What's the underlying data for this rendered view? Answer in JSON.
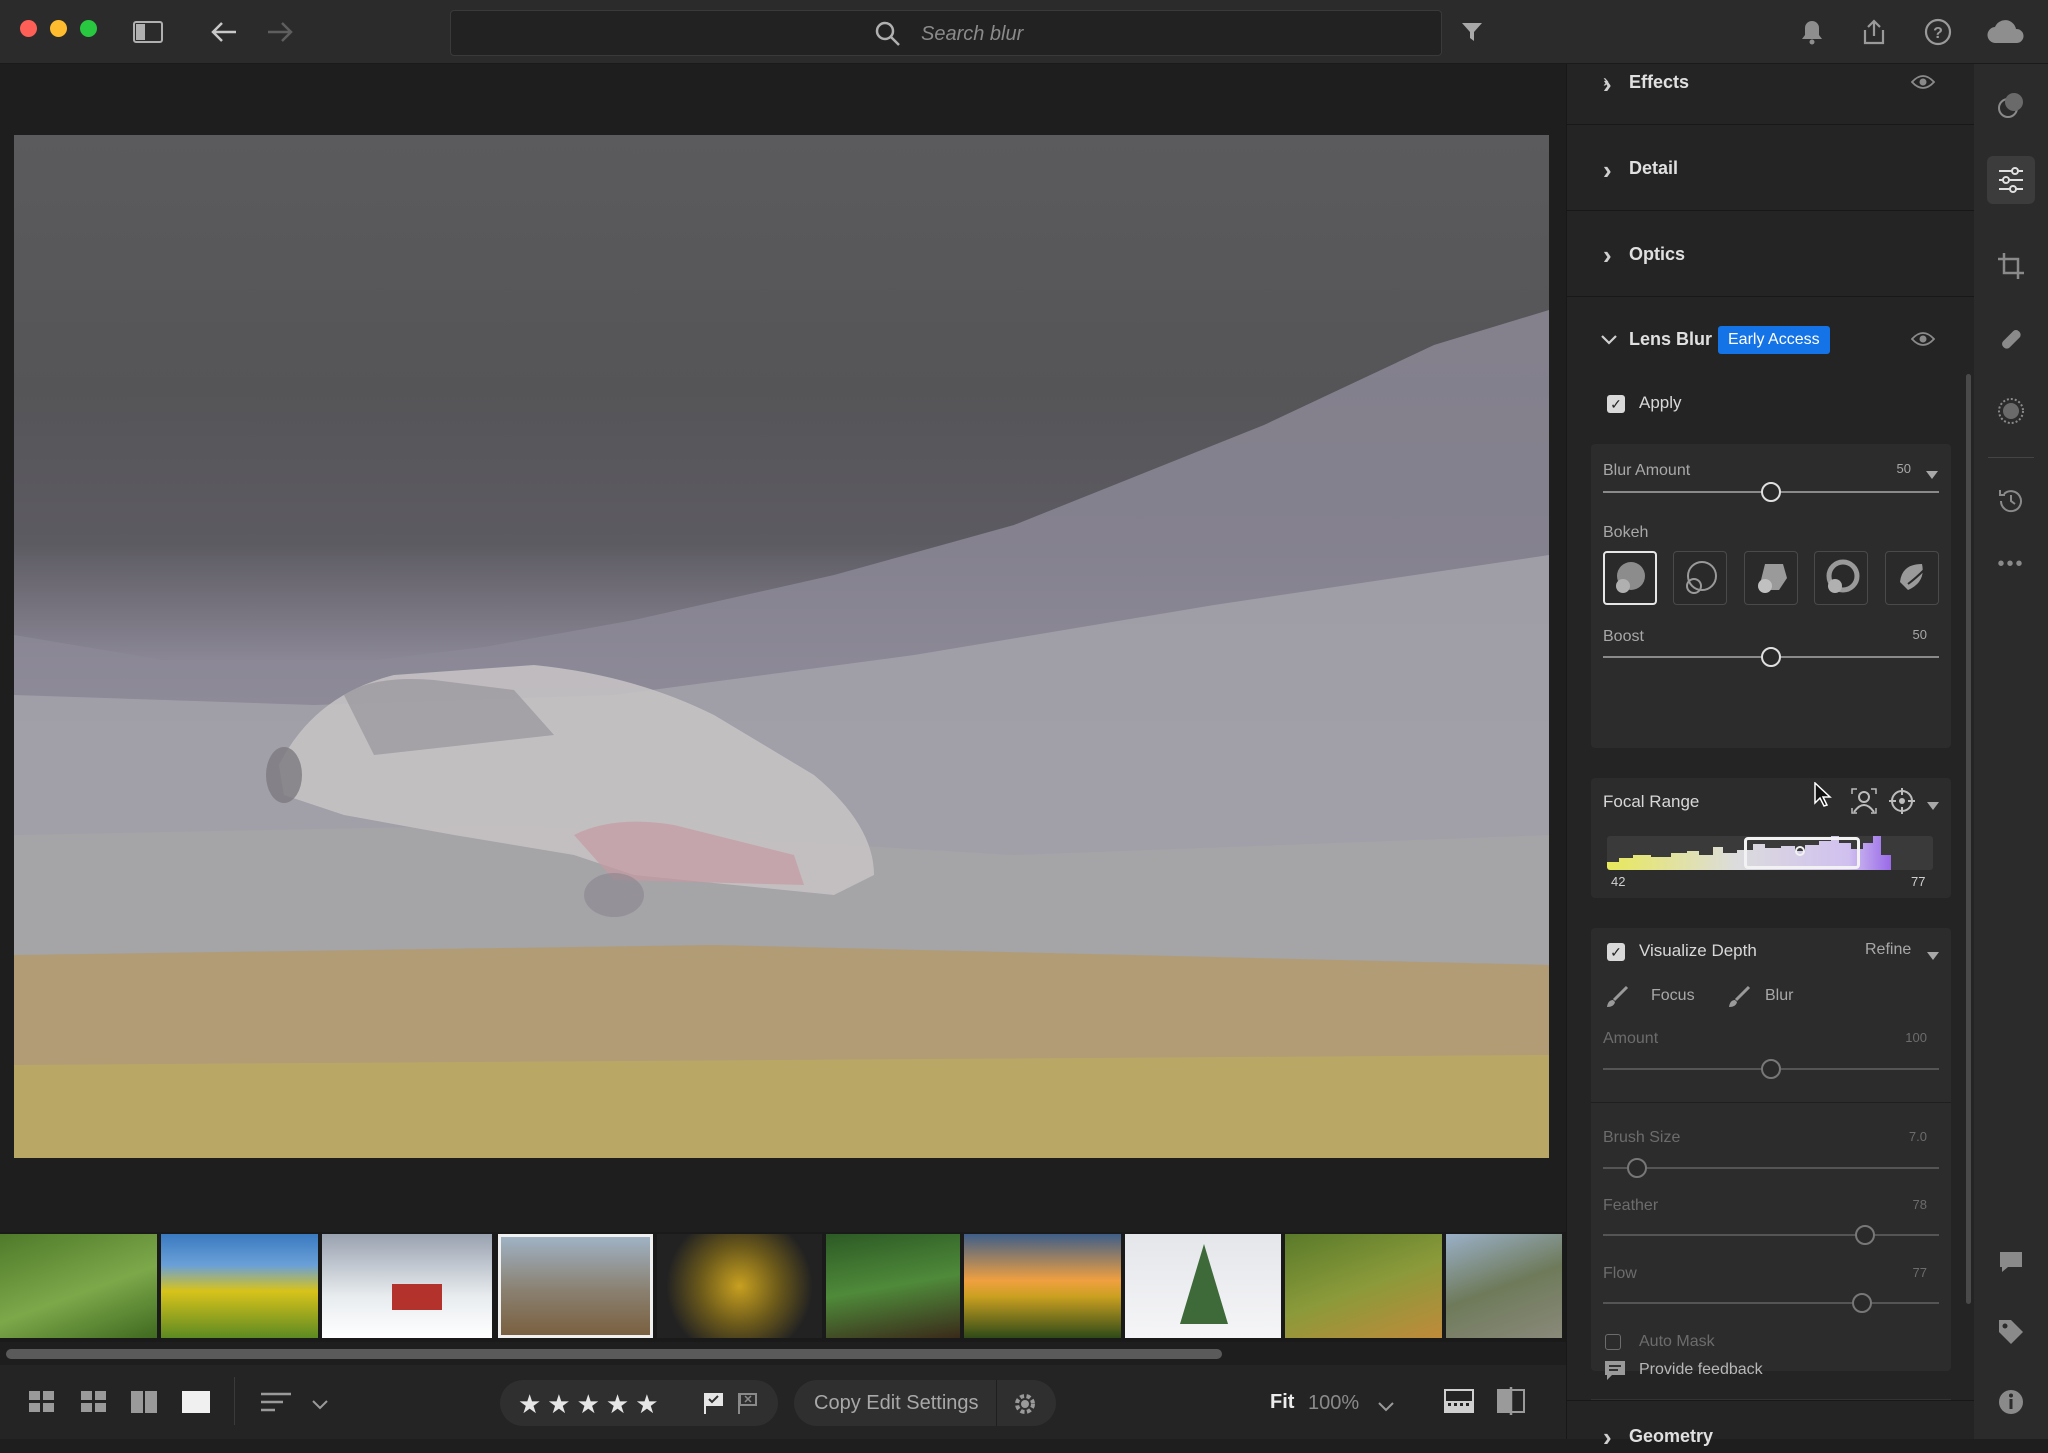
{
  "toolbar": {
    "search_placeholder": "Search blur"
  },
  "panel": {
    "sections": {
      "effects": "Effects",
      "detail": "Detail",
      "optics": "Optics",
      "lens_blur": "Lens Blur",
      "early_access": "Early Access",
      "geometry": "Geometry"
    },
    "apply_label": "Apply",
    "blur_amount": {
      "label": "Blur Amount",
      "value": "50",
      "level": 0.5
    },
    "bokeh_label": "Bokeh",
    "boost": {
      "label": "Boost",
      "value": "50",
      "level": 0.5
    },
    "focal_range": {
      "label": "Focal Range",
      "min": "42",
      "max": "77"
    },
    "visualize_depth": {
      "label": "Visualize Depth",
      "refine": "Refine"
    },
    "focus_label": "Focus",
    "blur_label": "Blur",
    "amount": {
      "label": "Amount",
      "value": "100",
      "level": 0.5
    },
    "brush_size": {
      "label": "Brush Size",
      "value": "7.0",
      "level": 0.1
    },
    "feather": {
      "label": "Feather",
      "value": "78",
      "level": 0.78
    },
    "flow": {
      "label": "Flow",
      "value": "77",
      "level": 0.77
    },
    "auto_mask_label": "Auto Mask",
    "feedback_label": "Provide feedback"
  },
  "bottom": {
    "copy_edit_settings": "Copy Edit Settings",
    "fit_label": "Fit",
    "zoom_label": "100%"
  },
  "colors": {
    "accent": "#1473e6",
    "panel_bg": "#242424",
    "app_bg": "#1e1e1e"
  }
}
